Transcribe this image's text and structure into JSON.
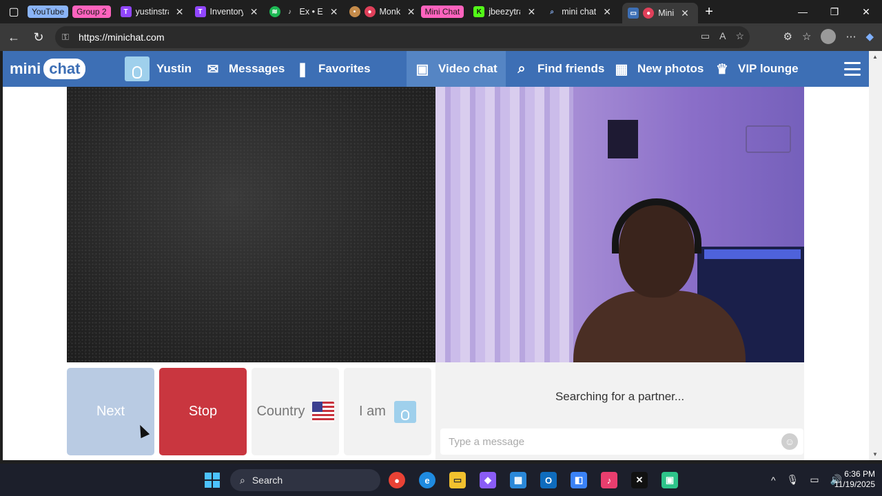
{
  "browser": {
    "tab_groups": [
      {
        "label": "YouTube",
        "color": "#8ab4f8"
      },
      {
        "label": "Group 2",
        "color": "#ff63be"
      },
      {
        "label": "Mini Chat",
        "color": "#ff63be"
      }
    ],
    "tabs": [
      {
        "title": "yustinstra"
      },
      {
        "title": "Inventory"
      },
      {
        "title": "Ex • E"
      },
      {
        "title": "Monk"
      },
      {
        "title": "jbeezytra"
      },
      {
        "title": "mini chat"
      },
      {
        "title": "Mini"
      }
    ],
    "url": "https://minichat.com"
  },
  "site": {
    "logo_mini": "mini",
    "logo_chat": "chat",
    "nav": {
      "user": "Yustin",
      "messages": "Messages",
      "favorites": "Favorites",
      "video_chat": "Video chat",
      "find_friends": "Find friends",
      "new_photos": "New photos",
      "vip_lounge": "VIP lounge"
    },
    "accent": "#3d6fb5",
    "controls": {
      "next": "Next",
      "stop": "Stop",
      "country": "Country",
      "i_am": "I am"
    },
    "status": "Searching for a partner...",
    "message_placeholder": "Type a message"
  },
  "taskbar": {
    "search_label": "Search",
    "time": "6:36 PM",
    "date": "11/19/2025"
  }
}
